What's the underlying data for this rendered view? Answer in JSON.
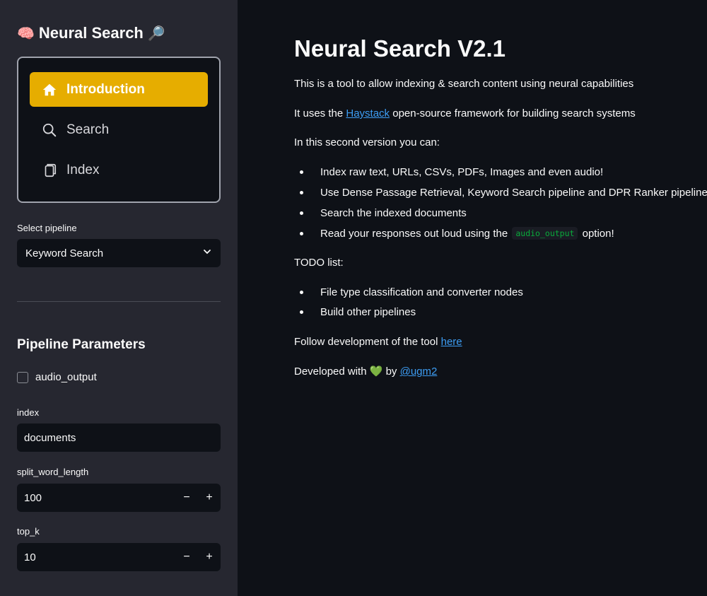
{
  "sidebar": {
    "app_title_emoji_left": "🧠",
    "app_title": "Neural Search",
    "app_title_emoji_right": "🔎",
    "nav": [
      {
        "label": "Introduction",
        "icon": "house-icon",
        "active": true
      },
      {
        "label": "Search",
        "icon": "search-icon",
        "active": false
      },
      {
        "label": "Index",
        "icon": "copy-icon",
        "active": false
      }
    ],
    "select_pipeline_label": "Select pipeline",
    "select_pipeline_value": "Keyword Search",
    "params_title": "Pipeline Parameters",
    "audio_output_label": "audio_output",
    "index_label": "index",
    "index_value": "documents",
    "split_word_length_label": "split_word_length",
    "split_word_length_value": "100",
    "top_k_label": "top_k",
    "top_k_value": "10",
    "minus": "−",
    "plus": "+"
  },
  "main": {
    "title": "Neural Search V2.1",
    "intro": "This is a tool to allow indexing & search content using neural capabilities",
    "haystack_prefix": "It uses the ",
    "haystack_link": "Haystack",
    "haystack_suffix": " open-source framework for building search systems",
    "second_version": "In this second version you can:",
    "features": [
      "Index raw text, URLs, CSVs, PDFs, Images and even audio!",
      "Use Dense Passage Retrieval, Keyword Search pipeline and DPR Ranker pipelines",
      "Search the indexed documents"
    ],
    "read_prefix": "Read your responses out loud using the",
    "read_code": "audio_output",
    "read_suffix": "option!",
    "todo_title": "TODO list:",
    "todo": [
      "File type classification and converter nodes",
      "Build other pipelines"
    ],
    "follow_prefix": "Follow development of the tool ",
    "follow_link": "here",
    "developed_prefix": "Developed with ",
    "developed_heart": "💚",
    "developed_by": " by ",
    "developed_link": "@ugm2"
  },
  "colors": {
    "sidebar_bg": "#262730",
    "main_bg": "#0e1117",
    "accent": "#e6ad00",
    "link": "#3d9df3",
    "code": "#09ab3b"
  }
}
